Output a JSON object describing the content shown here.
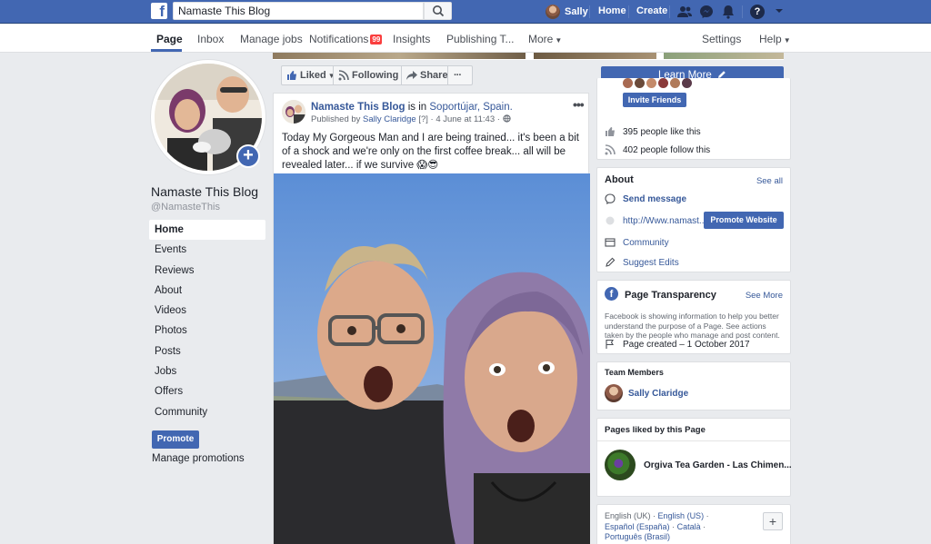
{
  "topbar": {
    "logo": "f",
    "search_value": "Namaste This Blog",
    "user_name": "Sally",
    "home": "Home",
    "create": "Create",
    "help_icon": "?"
  },
  "pagenav": {
    "items": [
      "Page",
      "Inbox",
      "Manage jobs",
      "Notifications",
      "Insights",
      "Publishing T...",
      "More"
    ],
    "notifications_count": "99",
    "settings": "Settings",
    "help": "Help"
  },
  "profile": {
    "name": "Namaste This Blog",
    "handle": "@NamasteThis",
    "add_icon": "+"
  },
  "leftnav": {
    "items": [
      "Home",
      "Events",
      "Reviews",
      "About",
      "Videos",
      "Photos",
      "Posts",
      "Jobs",
      "Offers",
      "Community"
    ],
    "promote": "Promote",
    "manage_promotions": "Manage promotions"
  },
  "actions": {
    "liked": "Liked",
    "following": "Following",
    "share": "Share",
    "more": "···",
    "learn_more": "Learn More"
  },
  "post": {
    "author": "Namaste This Blog",
    "is_in": "is in",
    "location": "Soportújar, Spain.",
    "published_by": "Published by",
    "publisher": "Sally Claridge",
    "qmark": "[?]",
    "date": "· 4 June at 11:43 ·",
    "menu": "•••",
    "text": "Today My Gorgeous Man and I are being trained... it's been a bit of a shock and we're only on the first coffee break... all will be revealed later... if we survive 😱😎"
  },
  "right": {
    "invite_friends": "Invite Friends",
    "likes": "395 people like this",
    "follows": "402 people follow this",
    "about_title": "About",
    "see_all": "See all",
    "send_message": "Send message",
    "website": "http://Www.namast...",
    "promote_website": "Promote Website",
    "community": "Community",
    "suggest_edits": "Suggest Edits",
    "pt_title": "Page Transparency",
    "see_more": "See More",
    "pt_desc": "Facebook is showing information to help you better understand the purpose of a Page. See actions taken by the people who manage and post content.",
    "page_created": "Page created – 1 October 2017",
    "team_title": "Team Members",
    "team_member": "Sally Claridge",
    "liked_title": "Pages liked by this Page",
    "liked_page": "Orgiva Tea Garden - Las Chimen...",
    "lang_english_uk": "English (UK)",
    "lang_english_us": "English (US)",
    "lang_espanol": "Español (España)",
    "lang_catala": "Català",
    "lang_portugues": "Português (Brasil)",
    "lang_sep": "·",
    "lang_plus": "+"
  },
  "colors": {
    "brand": "#4267b2",
    "link": "#365899",
    "badge": "#fa3e3e",
    "background": "#e9ebee"
  }
}
